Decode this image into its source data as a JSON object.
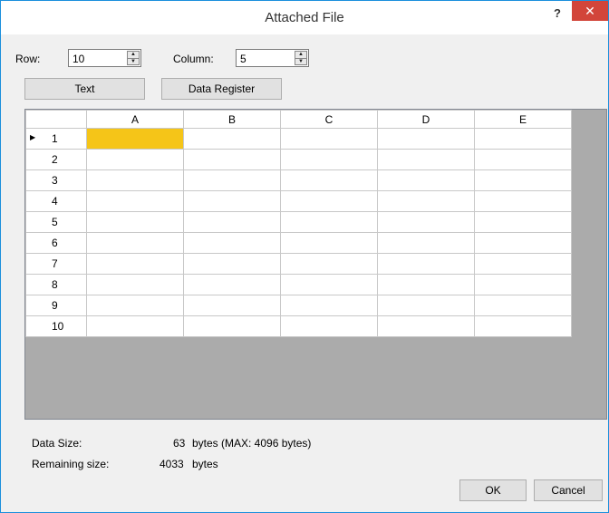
{
  "window": {
    "title": "Attached File",
    "help_label": "?",
    "close_label": "✕"
  },
  "row": {
    "label": "Row:",
    "value": "10"
  },
  "column": {
    "label": "Column:",
    "value": "5"
  },
  "buttons": {
    "text": "Text",
    "data_register": "Data Register",
    "ok": "OK",
    "cancel": "Cancel"
  },
  "grid": {
    "columns": [
      "A",
      "B",
      "C",
      "D",
      "E"
    ],
    "rows": [
      "1",
      "2",
      "3",
      "4",
      "5",
      "6",
      "7",
      "8",
      "9",
      "10"
    ],
    "current_row_marker": "▶",
    "selected_cell": "A1"
  },
  "info": {
    "data_size_label": "Data Size:",
    "data_size_value": "63",
    "data_size_unit": "bytes (MAX: 4096 bytes)",
    "remaining_label": "Remaining size:",
    "remaining_value": "4033",
    "remaining_unit": "bytes"
  },
  "colors": {
    "selected_cell": "#f5c518",
    "close_button": "#d2453a",
    "border": "#1b8fdc"
  }
}
